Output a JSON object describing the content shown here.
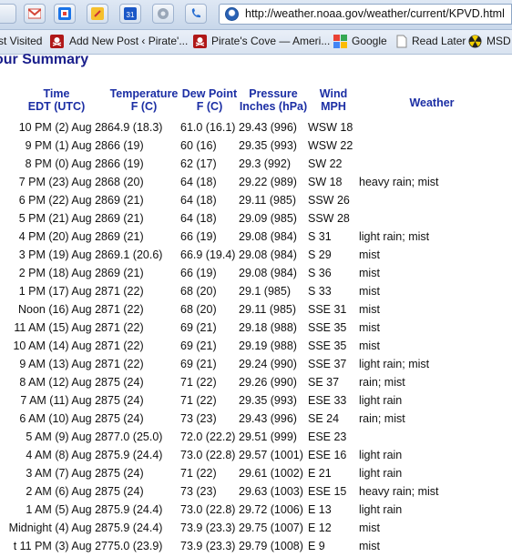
{
  "browser": {
    "url": "http://weather.noaa.gov/weather/current/KPVD.html",
    "toolbar_icons": [
      {
        "name": "gmail-icon",
        "color": "#d44638"
      },
      {
        "name": "google-chrome-icon",
        "color": "#1a73e8"
      },
      {
        "name": "calendar-icon",
        "color": "#1a57c7"
      },
      {
        "name": "settings-icon",
        "color": "#9aa7b8"
      },
      {
        "name": "phone-icon",
        "color": "#2a6fd1"
      }
    ],
    "bookmarks": [
      "st Visited",
      "Add New Post ‹ Pirate'...",
      "Pirate's Cove — Ameri...",
      "Google",
      "Read Later",
      "MSD"
    ]
  },
  "page": {
    "summary_title": "our Summary",
    "columns": {
      "time": [
        "Time",
        "EDT (UTC)"
      ],
      "temperature": [
        "Temperature",
        "F (C)"
      ],
      "dew_point": [
        "Dew Point",
        "F (C)"
      ],
      "pressure": [
        "Pressure",
        "Inches (hPa)"
      ],
      "wind": [
        "Wind",
        "MPH"
      ],
      "weather": [
        "Weather"
      ]
    },
    "rows": [
      {
        "time": "10 PM (2) Aug 28",
        "temp": "64.9 (18.3)",
        "dew": "61.0 (16.1)",
        "pressure": "29.43 (996)",
        "wind": "WSW 18",
        "weather": ""
      },
      {
        "time": "9 PM (1) Aug 28",
        "temp": "66 (19)",
        "dew": "60 (16)",
        "pressure": "29.35 (993)",
        "wind": "WSW 22",
        "weather": ""
      },
      {
        "time": "8 PM (0) Aug 28",
        "temp": "66 (19)",
        "dew": "62 (17)",
        "pressure": "29.3 (992)",
        "wind": "SW 22",
        "weather": ""
      },
      {
        "time": "7 PM (23) Aug 28",
        "temp": "68 (20)",
        "dew": "64 (18)",
        "pressure": "29.22 (989)",
        "wind": "SW 18",
        "weather": "heavy rain; mist"
      },
      {
        "time": "6 PM (22) Aug 28",
        "temp": "69 (21)",
        "dew": "64 (18)",
        "pressure": "29.11 (985)",
        "wind": "SSW 26",
        "weather": ""
      },
      {
        "time": "5 PM (21) Aug 28",
        "temp": "69 (21)",
        "dew": "64 (18)",
        "pressure": "29.09 (985)",
        "wind": "SSW 28",
        "weather": ""
      },
      {
        "time": "4 PM (20) Aug 28",
        "temp": "69 (21)",
        "dew": "66 (19)",
        "pressure": "29.08 (984)",
        "wind": "S 31",
        "weather": "light rain; mist"
      },
      {
        "time": "3 PM (19) Aug 28",
        "temp": "69.1 (20.6)",
        "dew": "66.9 (19.4)",
        "pressure": "29.08 (984)",
        "wind": "S 29",
        "weather": "mist"
      },
      {
        "time": "2 PM (18) Aug 28",
        "temp": "69 (21)",
        "dew": "66 (19)",
        "pressure": "29.08 (984)",
        "wind": "S 36",
        "weather": "mist"
      },
      {
        "time": "1 PM (17) Aug 28",
        "temp": "71 (22)",
        "dew": "68 (20)",
        "pressure": "29.1 (985)",
        "wind": "S 33",
        "weather": "mist"
      },
      {
        "time": "Noon (16) Aug 28",
        "temp": "71 (22)",
        "dew": "68 (20)",
        "pressure": "29.11 (985)",
        "wind": "SSE 31",
        "weather": "mist"
      },
      {
        "time": "11 AM (15) Aug 28",
        "temp": "71 (22)",
        "dew": "69 (21)",
        "pressure": "29.18 (988)",
        "wind": "SSE 35",
        "weather": "mist"
      },
      {
        "time": "10 AM (14) Aug 28",
        "temp": "71 (22)",
        "dew": "69 (21)",
        "pressure": "29.19 (988)",
        "wind": "SSE 35",
        "weather": "mist"
      },
      {
        "time": "9 AM (13) Aug 28",
        "temp": "71 (22)",
        "dew": "69 (21)",
        "pressure": "29.24 (990)",
        "wind": "SSE 37",
        "weather": "light rain; mist"
      },
      {
        "time": "8 AM (12) Aug 28",
        "temp": "75 (24)",
        "dew": "71 (22)",
        "pressure": "29.26 (990)",
        "wind": "SE 37",
        "weather": "rain; mist"
      },
      {
        "time": "7 AM (11) Aug 28",
        "temp": "75 (24)",
        "dew": "71 (22)",
        "pressure": "29.35 (993)",
        "wind": "ESE 33",
        "weather": "light rain"
      },
      {
        "time": "6 AM (10) Aug 28",
        "temp": "75 (24)",
        "dew": "73 (23)",
        "pressure": "29.43 (996)",
        "wind": "SE 24",
        "weather": "rain; mist"
      },
      {
        "time": "5 AM (9) Aug 28",
        "temp": "77.0 (25.0)",
        "dew": "72.0 (22.2)",
        "pressure": "29.51 (999)",
        "wind": "ESE 23",
        "weather": ""
      },
      {
        "time": "4 AM (8) Aug 28",
        "temp": "75.9 (24.4)",
        "dew": "73.0 (22.8)",
        "pressure": "29.57 (1001)",
        "wind": "ESE 16",
        "weather": "light rain"
      },
      {
        "time": "3 AM (7) Aug 28",
        "temp": "75 (24)",
        "dew": "71 (22)",
        "pressure": "29.61 (1002)",
        "wind": "E 21",
        "weather": "light rain"
      },
      {
        "time": "2 AM (6) Aug 28",
        "temp": "75 (24)",
        "dew": "73 (23)",
        "pressure": "29.63 (1003)",
        "wind": "ESE 15",
        "weather": "heavy rain; mist"
      },
      {
        "time": "1 AM (5) Aug 28",
        "temp": "75.9 (24.4)",
        "dew": "73.0 (22.8)",
        "pressure": "29.72 (1006)",
        "wind": "E 13",
        "weather": "light rain"
      },
      {
        "time": "Midnight (4) Aug 28",
        "temp": "75.9 (24.4)",
        "dew": "73.9 (23.3)",
        "pressure": "29.75 (1007)",
        "wind": "E 12",
        "weather": "mist"
      },
      {
        "time": "t 11 PM (3) Aug 27",
        "temp": "75.0 (23.9)",
        "dew": "73.9 (23.3)",
        "pressure": "29.79 (1008)",
        "wind": "E 9",
        "weather": "mist"
      }
    ]
  }
}
